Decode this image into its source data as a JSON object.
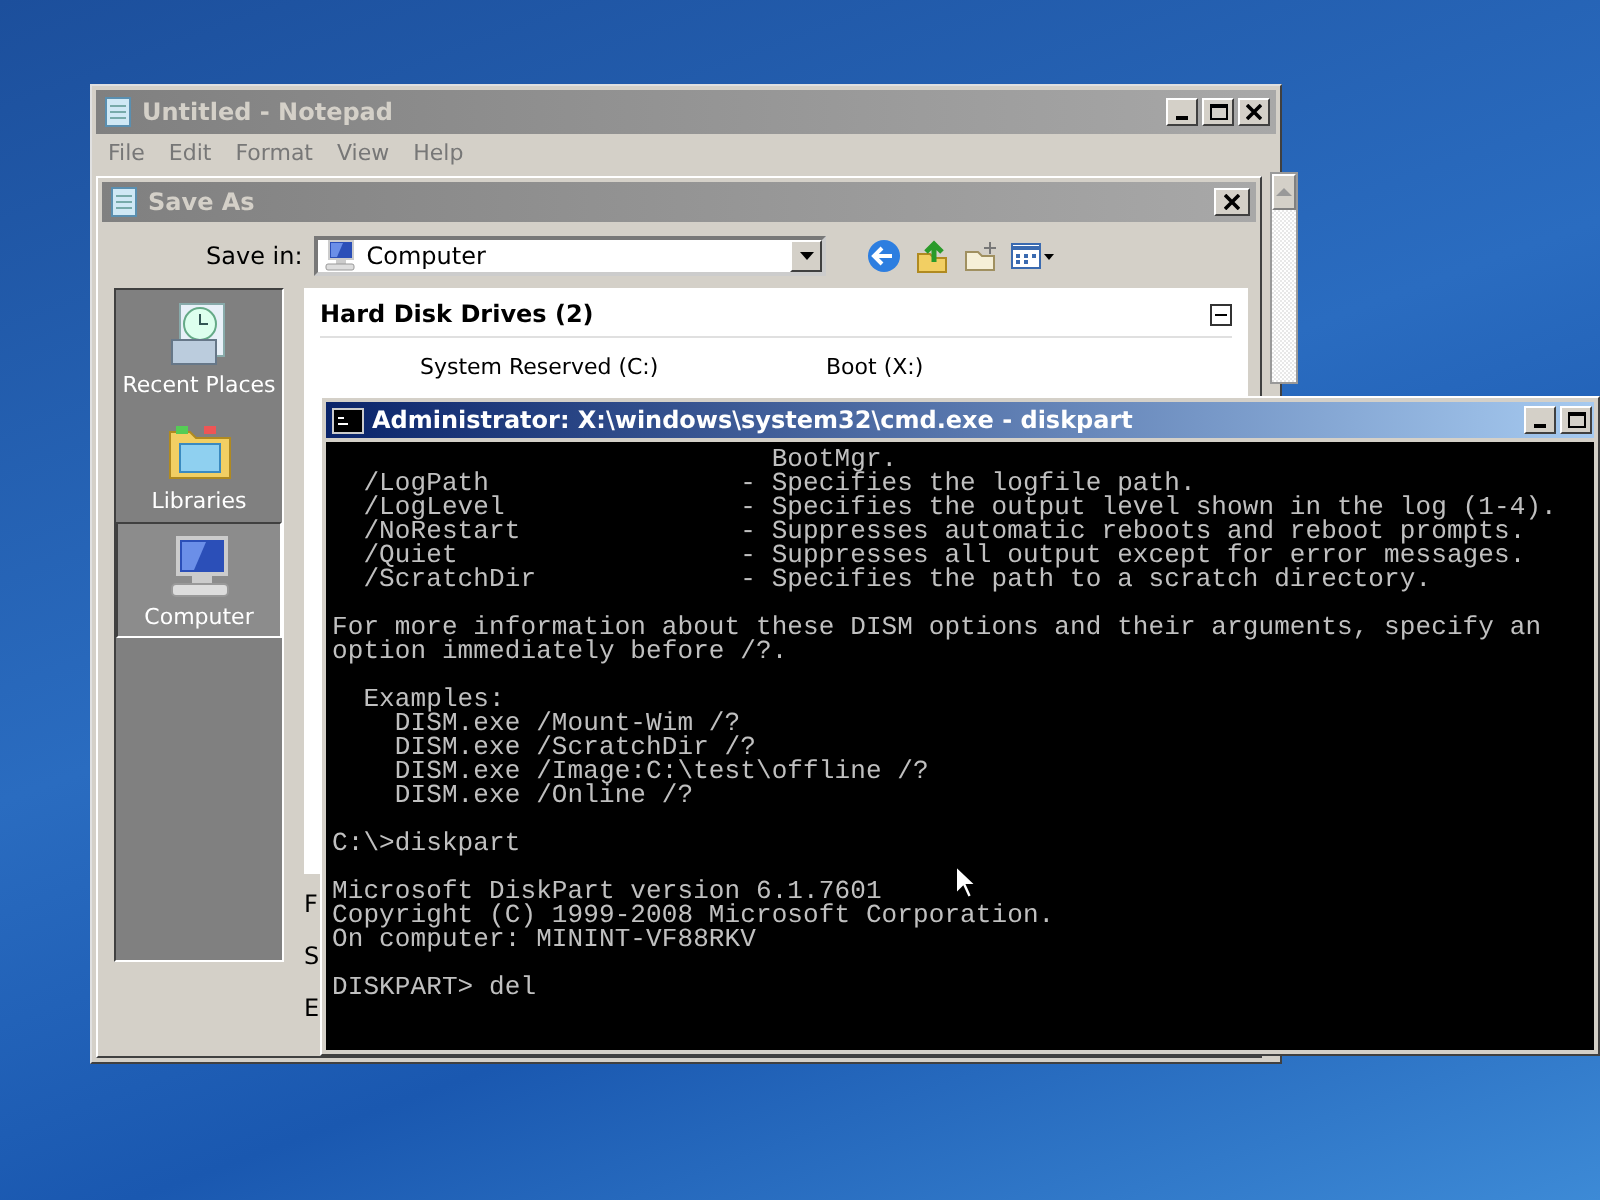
{
  "notepad": {
    "title": "Untitled - Notepad",
    "menu": [
      "File",
      "Edit",
      "Format",
      "View",
      "Help"
    ]
  },
  "save_as": {
    "title": "Save As",
    "save_in_label": "Save in:",
    "location": "Computer",
    "places": [
      {
        "label": "Recent Places",
        "kind": "recent",
        "selected": false
      },
      {
        "label": "Libraries",
        "kind": "libraries",
        "selected": false
      },
      {
        "label": "Computer",
        "kind": "computer",
        "selected": true
      }
    ],
    "group": {
      "title": "Hard Disk Drives (2)",
      "expanded": true,
      "drives": [
        "System Reserved (C:)",
        "Boot (X:)"
      ]
    },
    "field_labels": [
      "F",
      "S",
      "E"
    ]
  },
  "console": {
    "title": "Administrator: X:\\windows\\system32\\cmd.exe - diskpart",
    "blocks": [
      {
        "lines": [
          "                            BootMgr.",
          "  /LogPath                - Specifies the logfile path.",
          "  /LogLevel               - Specifies the output level shown in the log (1-4).",
          "  /NoRestart              - Suppresses automatic reboots and reboot prompts.",
          "  /Quiet                  - Suppresses all output except for error messages.",
          "  /ScratchDir             - Specifies the path to a scratch directory."
        ]
      },
      {
        "lines": [
          "For more information about these DISM options and their arguments, specify an",
          "option immediately before /?."
        ]
      },
      {
        "lines": [
          "  Examples:",
          "    DISM.exe /Mount-Wim /?",
          "    DISM.exe /ScratchDir /?",
          "    DISM.exe /Image:C:\\test\\offline /?",
          "    DISM.exe /Online /?"
        ]
      },
      {
        "lines": [
          "C:\\>diskpart"
        ]
      },
      {
        "lines": [
          "Microsoft DiskPart version 6.1.7601",
          "Copyright (C) 1999-2008 Microsoft Corporation.",
          "On computer: MININT-VF88RKV"
        ]
      },
      {
        "lines": [
          "DISKPART> del"
        ]
      }
    ]
  }
}
